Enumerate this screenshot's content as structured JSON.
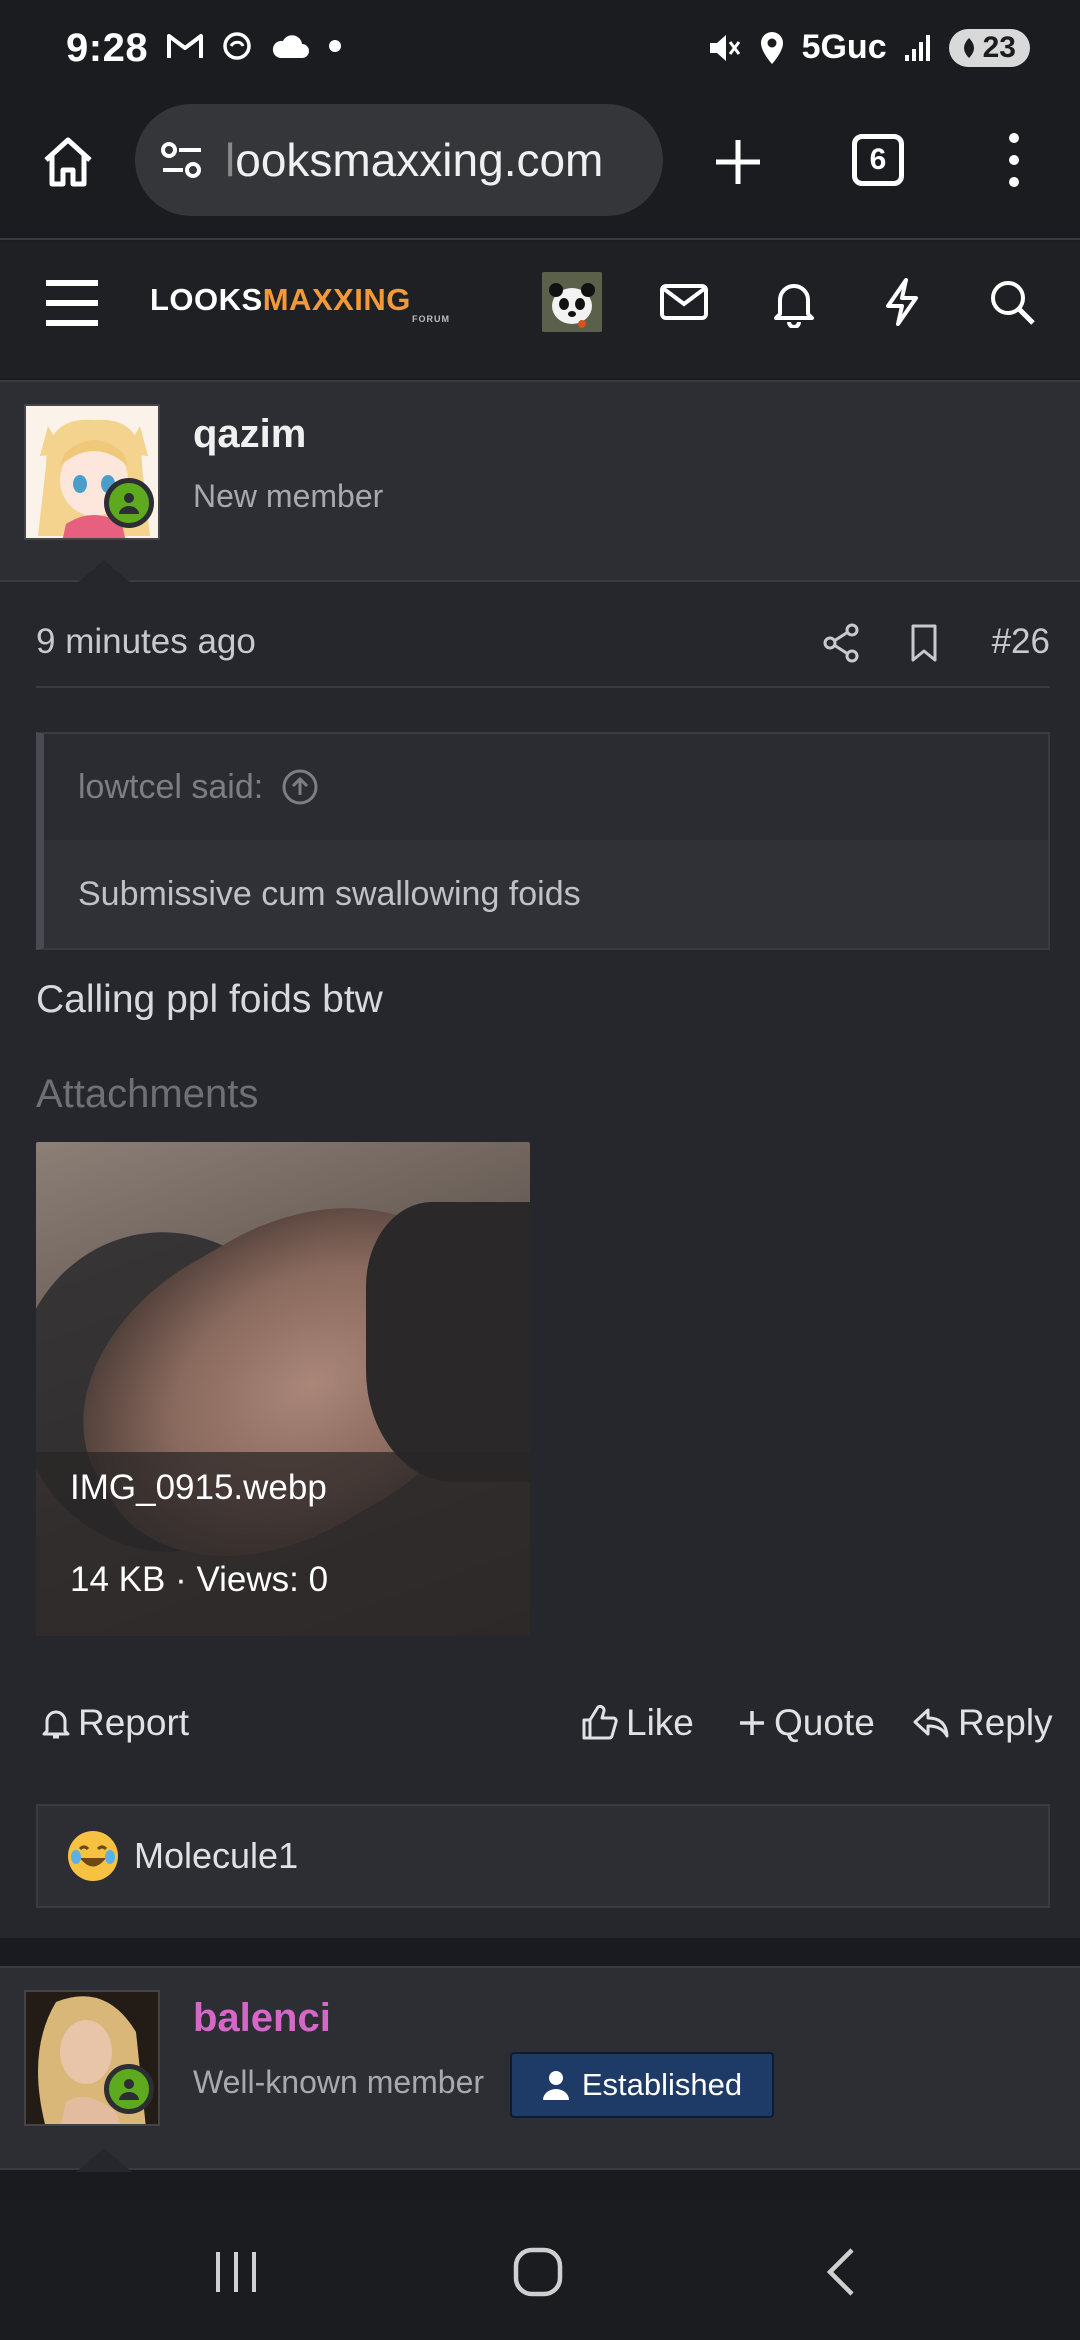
{
  "status_bar": {
    "time": "9:28",
    "network": "5Guc",
    "battery": "23"
  },
  "browser": {
    "url_prefix": "l",
    "url": "ooksmaxxing.com",
    "tab_count": "6"
  },
  "site": {
    "logo_left": "LOOKS",
    "logo_right": "MAXXING",
    "logo_sub": "FORUM"
  },
  "post": {
    "username": "qazim",
    "user_title": "New member",
    "time": "9 minutes ago",
    "post_number": "#26",
    "quote_author": "lowtcel said:",
    "quote_text": "Submissive cum swallowing foids",
    "message": "Calling ppl foids btw",
    "attachments_label": "Attachments",
    "attachment": {
      "filename": "IMG_0915.webp",
      "meta": "14 KB · Views: 0"
    },
    "actions": {
      "report": "Report",
      "like": "Like",
      "quote": "Quote",
      "reply": "Reply"
    },
    "reaction_user": "Molecule1"
  },
  "next_post": {
    "username": "balenci",
    "user_title": "Well-known member",
    "badge": "Established",
    "username_color": "#d468c8"
  },
  "colors": {
    "accent_orange": "#f29a3a",
    "online_green": "#5eaa1f",
    "badge_blue": "#1e3a66"
  }
}
